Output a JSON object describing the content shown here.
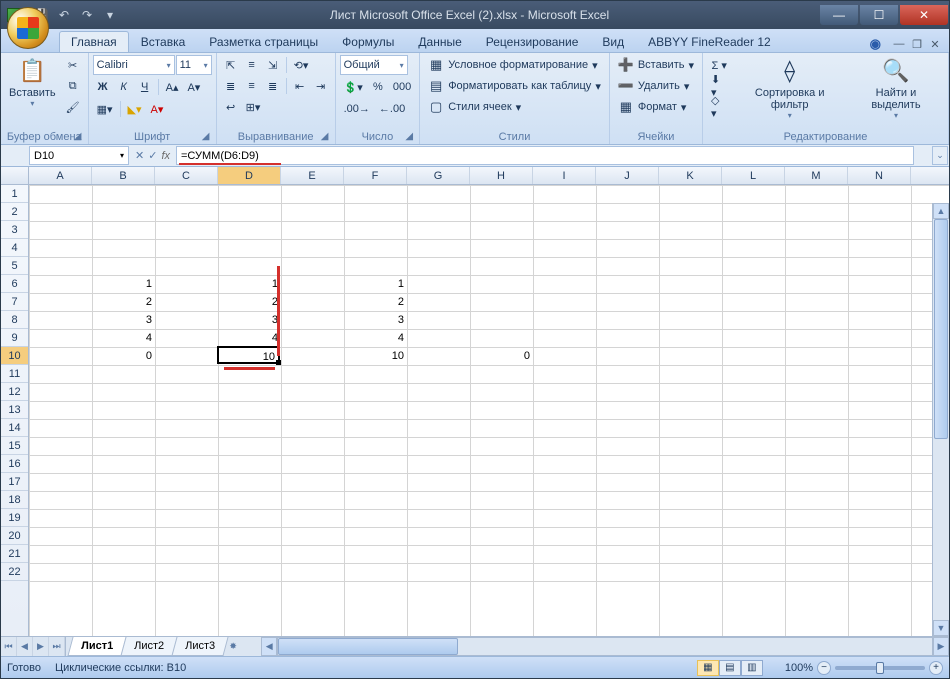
{
  "titlebar": {
    "title": "Лист Microsoft Office Excel (2).xlsx - Microsoft Excel"
  },
  "tabs": {
    "items": [
      "Главная",
      "Вставка",
      "Разметка страницы",
      "Формулы",
      "Данные",
      "Рецензирование",
      "Вид",
      "ABBYY FineReader 12"
    ],
    "active": 0
  },
  "ribbon": {
    "clipboard": {
      "label": "Буфер обмена",
      "paste": "Вставить"
    },
    "font": {
      "label": "Шрифт",
      "name": "Calibri",
      "size": "11",
      "bold": "Ж",
      "italic": "К",
      "underline": "Ч"
    },
    "alignment": {
      "label": "Выравнивание"
    },
    "number": {
      "label": "Число",
      "format": "Общий"
    },
    "styles": {
      "label": "Стили",
      "cond": "Условное форматирование",
      "table": "Форматировать как таблицу",
      "cell": "Стили ячеек"
    },
    "cells": {
      "label": "Ячейки",
      "insert": "Вставить",
      "delete": "Удалить",
      "format": "Формат"
    },
    "editing": {
      "label": "Редактирование",
      "sort": "Сортировка и фильтр",
      "find": "Найти и выделить"
    }
  },
  "formula_bar": {
    "name_box": "D10",
    "formula": "=СУММ(D6:D9)",
    "underline_width": 102
  },
  "grid": {
    "columns": [
      "A",
      "B",
      "C",
      "D",
      "E",
      "F",
      "G",
      "H",
      "I",
      "J",
      "K",
      "L",
      "M",
      "N"
    ],
    "rows": 22,
    "active_col": "D",
    "active_row": 10,
    "selected": {
      "col": 3,
      "row": 9
    },
    "cells": [
      {
        "col": 1,
        "row": 5,
        "v": "1"
      },
      {
        "col": 1,
        "row": 6,
        "v": "2"
      },
      {
        "col": 1,
        "row": 7,
        "v": "3"
      },
      {
        "col": 1,
        "row": 8,
        "v": "4"
      },
      {
        "col": 1,
        "row": 9,
        "v": "0"
      },
      {
        "col": 3,
        "row": 5,
        "v": "1"
      },
      {
        "col": 3,
        "row": 6,
        "v": "2"
      },
      {
        "col": 3,
        "row": 7,
        "v": "3"
      },
      {
        "col": 3,
        "row": 8,
        "v": "4"
      },
      {
        "col": 3,
        "row": 9,
        "v": "10"
      },
      {
        "col": 5,
        "row": 5,
        "v": "1"
      },
      {
        "col": 5,
        "row": 6,
        "v": "2"
      },
      {
        "col": 5,
        "row": 7,
        "v": "3"
      },
      {
        "col": 5,
        "row": 8,
        "v": "4"
      },
      {
        "col": 5,
        "row": 9,
        "v": "10"
      },
      {
        "col": 7,
        "row": 9,
        "v": "0"
      }
    ],
    "annotations": {
      "red_v": {
        "col": 3,
        "row_start": 4.5,
        "row_end": 9
      },
      "red_h": {
        "col": 3,
        "row": 10
      }
    }
  },
  "sheets": {
    "items": [
      "Лист1",
      "Лист2",
      "Лист3"
    ],
    "active": 0
  },
  "statusbar": {
    "ready": "Готово",
    "circular": "Циклические ссылки: B10",
    "zoom": "100%"
  }
}
